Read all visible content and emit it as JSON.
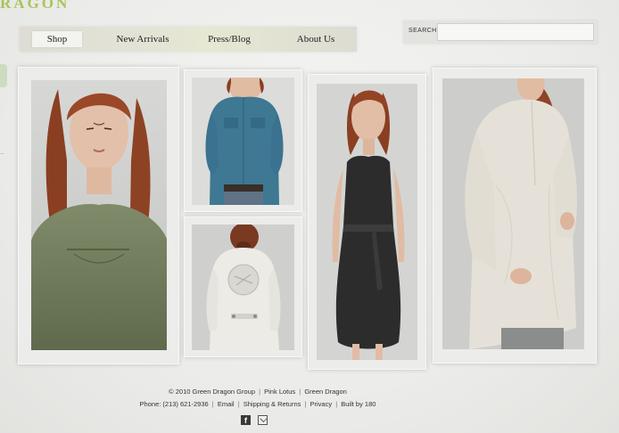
{
  "brand": {
    "logo_text": "RAGON",
    "accent": "#a9c35a"
  },
  "nav": {
    "items": [
      {
        "label": "Shop"
      },
      {
        "label": "New Arrivals"
      },
      {
        "label": "Press/Blog"
      },
      {
        "label": "About Us"
      }
    ],
    "active": "Shop"
  },
  "search": {
    "label": "SEARCH",
    "value": "",
    "placeholder": ""
  },
  "gallery": [
    {
      "name": "model-green-top"
    },
    {
      "name": "model-blue-shirt"
    },
    {
      "name": "model-white-jacket"
    },
    {
      "name": "model-black-dress"
    },
    {
      "name": "model-ivory-tunic"
    }
  ],
  "footer": {
    "copyright": "© 2010 Green Dragon Group",
    "link_pink_lotus": "Pink Lotus",
    "link_green_dragon": "Green Dragon",
    "phone": "Phone: (213) 621-2936",
    "link_email": "Email",
    "link_shipping": "Shipping & Returns",
    "link_privacy": "Privacy",
    "link_built": "Built by 180",
    "separator": "|"
  },
  "social": {
    "facebook_icon": "facebook-icon",
    "email_icon": "envelope-icon"
  }
}
